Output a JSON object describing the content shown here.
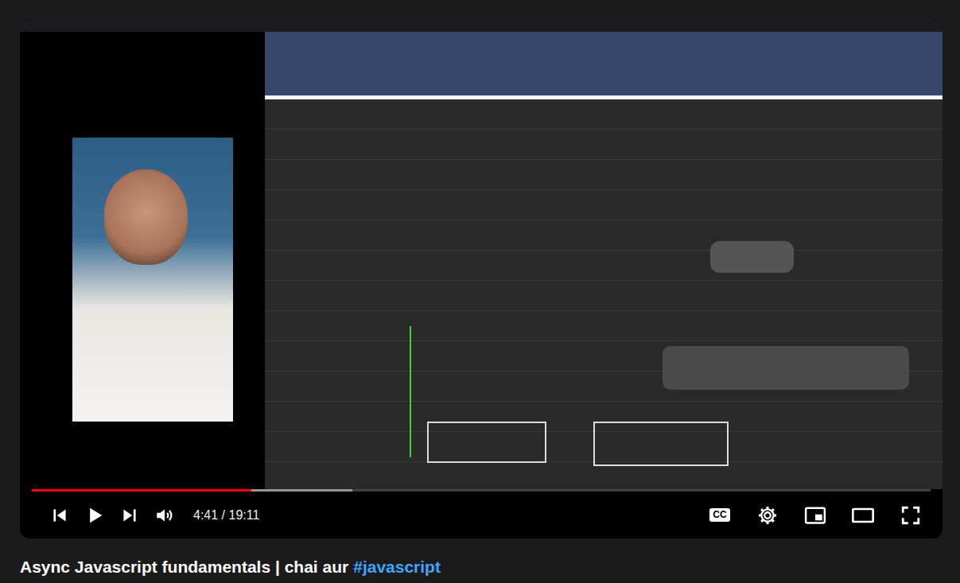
{
  "player": {
    "playing": false,
    "muted": false,
    "progress": {
      "level": 0.244,
      "buffered": 0.357
    },
    "time": "4:41 / 19:11",
    "captions_label": "CC"
  },
  "video": {
    "title": "Async Javascript fundamentals | chai aur",
    "hashtag": "#javascript"
  }
}
